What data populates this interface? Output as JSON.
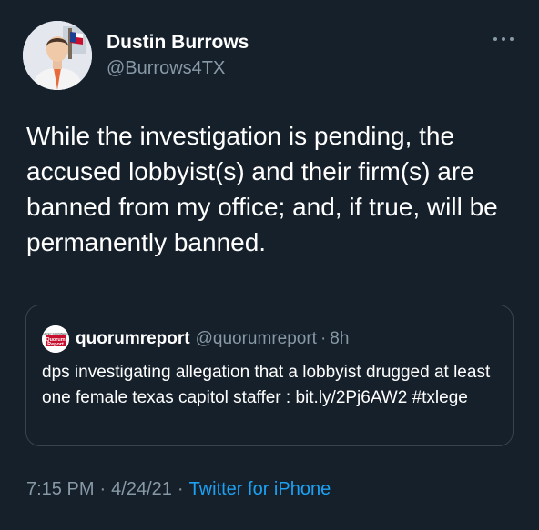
{
  "author": {
    "name": "Dustin Burrows",
    "handle": "@Burrows4TX"
  },
  "more_icon": "more-horizontal-icon",
  "tweet": {
    "text": "While the investigation is pending, the accused lobbyist(s) and their firm(s) are banned from my office; and, if true, will be permanently banned."
  },
  "quoted_tweet": {
    "name": "quorumreport",
    "handle": "@quorumreport",
    "separator": "·",
    "time": "8h",
    "avatar_text": [
      "HARVEY KRONBERG'S",
      "Quorum",
      "Report"
    ],
    "text": "dps investigating allegation that a lobbyist drugged at least one female texas capitol staffer : bit.ly/2Pj6AW2 #txlege"
  },
  "meta": {
    "time": "7:15 PM",
    "separator": "·",
    "date": "4/24/21",
    "source": "Twitter for iPhone"
  },
  "colors": {
    "background": "#15202b",
    "text": "#ffffff",
    "secondary": "#8899a6",
    "link": "#1da1f2",
    "border": "#38444d"
  }
}
